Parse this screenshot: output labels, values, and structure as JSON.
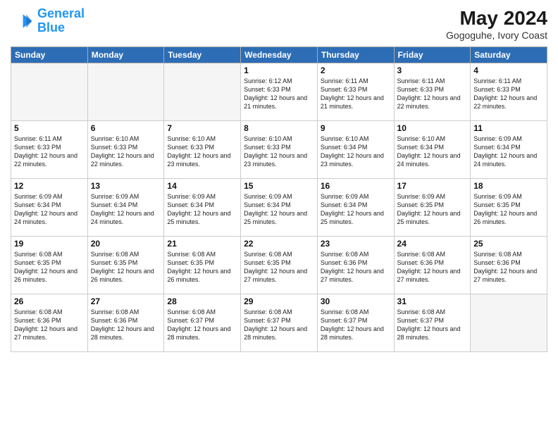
{
  "logo": {
    "line1": "General",
    "line2": "Blue"
  },
  "title": "May 2024",
  "location": "Gogoguhe, Ivory Coast",
  "weekdays": [
    "Sunday",
    "Monday",
    "Tuesday",
    "Wednesday",
    "Thursday",
    "Friday",
    "Saturday"
  ],
  "weeks": [
    [
      {
        "day": "",
        "info": ""
      },
      {
        "day": "",
        "info": ""
      },
      {
        "day": "",
        "info": ""
      },
      {
        "day": "1",
        "info": "Sunrise: 6:12 AM\nSunset: 6:33 PM\nDaylight: 12 hours\nand 21 minutes."
      },
      {
        "day": "2",
        "info": "Sunrise: 6:11 AM\nSunset: 6:33 PM\nDaylight: 12 hours\nand 21 minutes."
      },
      {
        "day": "3",
        "info": "Sunrise: 6:11 AM\nSunset: 6:33 PM\nDaylight: 12 hours\nand 22 minutes."
      },
      {
        "day": "4",
        "info": "Sunrise: 6:11 AM\nSunset: 6:33 PM\nDaylight: 12 hours\nand 22 minutes."
      }
    ],
    [
      {
        "day": "5",
        "info": "Sunrise: 6:11 AM\nSunset: 6:33 PM\nDaylight: 12 hours\nand 22 minutes."
      },
      {
        "day": "6",
        "info": "Sunrise: 6:10 AM\nSunset: 6:33 PM\nDaylight: 12 hours\nand 22 minutes."
      },
      {
        "day": "7",
        "info": "Sunrise: 6:10 AM\nSunset: 6:33 PM\nDaylight: 12 hours\nand 23 minutes."
      },
      {
        "day": "8",
        "info": "Sunrise: 6:10 AM\nSunset: 6:33 PM\nDaylight: 12 hours\nand 23 minutes."
      },
      {
        "day": "9",
        "info": "Sunrise: 6:10 AM\nSunset: 6:34 PM\nDaylight: 12 hours\nand 23 minutes."
      },
      {
        "day": "10",
        "info": "Sunrise: 6:10 AM\nSunset: 6:34 PM\nDaylight: 12 hours\nand 24 minutes."
      },
      {
        "day": "11",
        "info": "Sunrise: 6:09 AM\nSunset: 6:34 PM\nDaylight: 12 hours\nand 24 minutes."
      }
    ],
    [
      {
        "day": "12",
        "info": "Sunrise: 6:09 AM\nSunset: 6:34 PM\nDaylight: 12 hours\nand 24 minutes."
      },
      {
        "day": "13",
        "info": "Sunrise: 6:09 AM\nSunset: 6:34 PM\nDaylight: 12 hours\nand 24 minutes."
      },
      {
        "day": "14",
        "info": "Sunrise: 6:09 AM\nSunset: 6:34 PM\nDaylight: 12 hours\nand 25 minutes."
      },
      {
        "day": "15",
        "info": "Sunrise: 6:09 AM\nSunset: 6:34 PM\nDaylight: 12 hours\nand 25 minutes."
      },
      {
        "day": "16",
        "info": "Sunrise: 6:09 AM\nSunset: 6:34 PM\nDaylight: 12 hours\nand 25 minutes."
      },
      {
        "day": "17",
        "info": "Sunrise: 6:09 AM\nSunset: 6:35 PM\nDaylight: 12 hours\nand 25 minutes."
      },
      {
        "day": "18",
        "info": "Sunrise: 6:09 AM\nSunset: 6:35 PM\nDaylight: 12 hours\nand 26 minutes."
      }
    ],
    [
      {
        "day": "19",
        "info": "Sunrise: 6:08 AM\nSunset: 6:35 PM\nDaylight: 12 hours\nand 26 minutes."
      },
      {
        "day": "20",
        "info": "Sunrise: 6:08 AM\nSunset: 6:35 PM\nDaylight: 12 hours\nand 26 minutes."
      },
      {
        "day": "21",
        "info": "Sunrise: 6:08 AM\nSunset: 6:35 PM\nDaylight: 12 hours\nand 26 minutes."
      },
      {
        "day": "22",
        "info": "Sunrise: 6:08 AM\nSunset: 6:35 PM\nDaylight: 12 hours\nand 27 minutes."
      },
      {
        "day": "23",
        "info": "Sunrise: 6:08 AM\nSunset: 6:36 PM\nDaylight: 12 hours\nand 27 minutes."
      },
      {
        "day": "24",
        "info": "Sunrise: 6:08 AM\nSunset: 6:36 PM\nDaylight: 12 hours\nand 27 minutes."
      },
      {
        "day": "25",
        "info": "Sunrise: 6:08 AM\nSunset: 6:36 PM\nDaylight: 12 hours\nand 27 minutes."
      }
    ],
    [
      {
        "day": "26",
        "info": "Sunrise: 6:08 AM\nSunset: 6:36 PM\nDaylight: 12 hours\nand 27 minutes."
      },
      {
        "day": "27",
        "info": "Sunrise: 6:08 AM\nSunset: 6:36 PM\nDaylight: 12 hours\nand 28 minutes."
      },
      {
        "day": "28",
        "info": "Sunrise: 6:08 AM\nSunset: 6:37 PM\nDaylight: 12 hours\nand 28 minutes."
      },
      {
        "day": "29",
        "info": "Sunrise: 6:08 AM\nSunset: 6:37 PM\nDaylight: 12 hours\nand 28 minutes."
      },
      {
        "day": "30",
        "info": "Sunrise: 6:08 AM\nSunset: 6:37 PM\nDaylight: 12 hours\nand 28 minutes."
      },
      {
        "day": "31",
        "info": "Sunrise: 6:08 AM\nSunset: 6:37 PM\nDaylight: 12 hours\nand 28 minutes."
      },
      {
        "day": "",
        "info": ""
      }
    ]
  ]
}
